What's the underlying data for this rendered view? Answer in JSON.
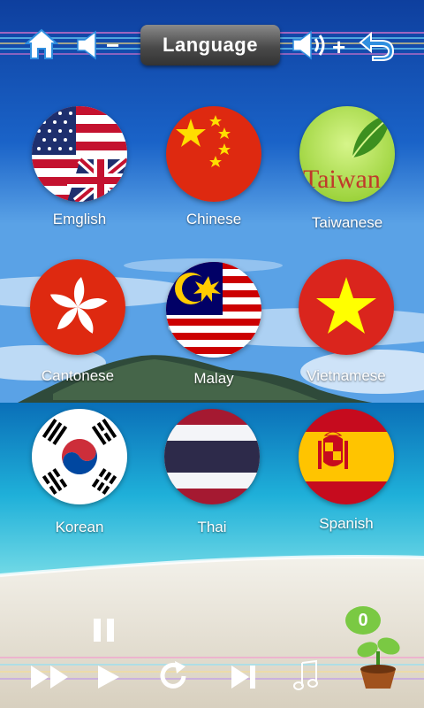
{
  "header": {
    "title": "Language",
    "home_icon": "home-icon",
    "volume_down_icon": "volume-down-icon",
    "volume_down_sign": "−",
    "volume_up_icon": "volume-up-icon",
    "volume_up_sign": "+",
    "back_icon": "back-arrow-icon"
  },
  "languages": [
    {
      "label": "Emglish",
      "flag": "us-uk-flag"
    },
    {
      "label": "Chinese",
      "flag": "china-flag"
    },
    {
      "label": "Taiwanese",
      "flag": "taiwan-leaf-flag",
      "flag_text": "Taiwan"
    },
    {
      "label": "Cantonese",
      "flag": "hong-kong-flag"
    },
    {
      "label": "Malay",
      "flag": "malaysia-flag"
    },
    {
      "label": "Vietnamese",
      "flag": "vietnam-flag"
    },
    {
      "label": "Korean",
      "flag": "korea-flag"
    },
    {
      "label": "Thai",
      "flag": "thailand-flag"
    },
    {
      "label": "Spanish",
      "flag": "spain-flag"
    }
  ],
  "controls": {
    "pause_icon": "pause-icon",
    "fast_forward_icon": "fast-forward-icon",
    "play_icon": "play-icon",
    "repeat_icon": "repeat-icon",
    "skip_end_icon": "skip-to-end-icon",
    "music_icon": "music-note-icon",
    "plant_icon": "sprout-pot-icon",
    "score": "0"
  },
  "colors": {
    "sky": "#1f6fd1",
    "sea": "#2fb8d8",
    "sand": "#e9e4d8",
    "icon_blue": "#2f8fe0"
  }
}
